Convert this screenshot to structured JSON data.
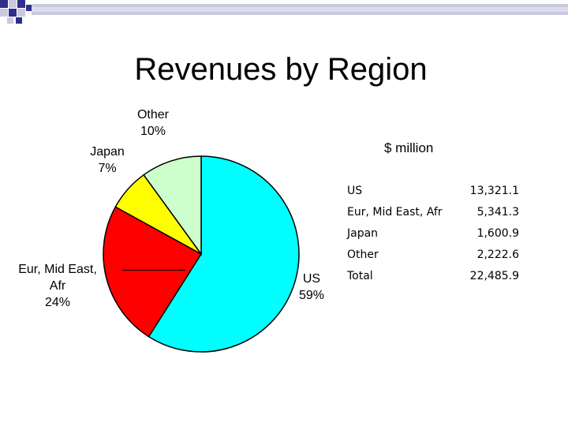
{
  "title": "Revenues by Region",
  "units_label": "$ million",
  "colors": {
    "us": "#00ffff",
    "eur": "#ff0000",
    "japan": "#ffff00",
    "other": "#ccffcc",
    "bullet_blue": "#2e2e8f",
    "bullet_light": "#c9c9e0"
  },
  "table": {
    "rows": [
      {
        "name": "US",
        "value": "13,321.1"
      },
      {
        "name": "Eur, Mid East, Afr",
        "value": "5,341.3"
      },
      {
        "name": "Japan",
        "value": "1,600.9"
      },
      {
        "name": "Other",
        "value": "2,222.6"
      },
      {
        "name": "Total",
        "value": "22,485.9"
      }
    ]
  },
  "chart_data": {
    "type": "pie",
    "title": "",
    "series": [
      {
        "name": "US",
        "value": 59,
        "label": "59%",
        "color": "#00ffff"
      },
      {
        "name": "Eur, Mid East, Afr",
        "value": 24,
        "label": "24%",
        "color": "#ff0000"
      },
      {
        "name": "Japan",
        "value": 7,
        "label": "7%",
        "color": "#ffff00"
      },
      {
        "name": "Other",
        "value": 10,
        "label": "10%",
        "color": "#ccffcc"
      }
    ],
    "labels": {
      "other": {
        "name": "Other",
        "pct": "10%"
      },
      "japan": {
        "name": "Japan",
        "pct": "7%"
      },
      "eur": {
        "line1": "Eur, Mid East,",
        "line2": "Afr",
        "pct": "24%"
      },
      "us": {
        "name": "US",
        "pct": "59%"
      }
    }
  }
}
